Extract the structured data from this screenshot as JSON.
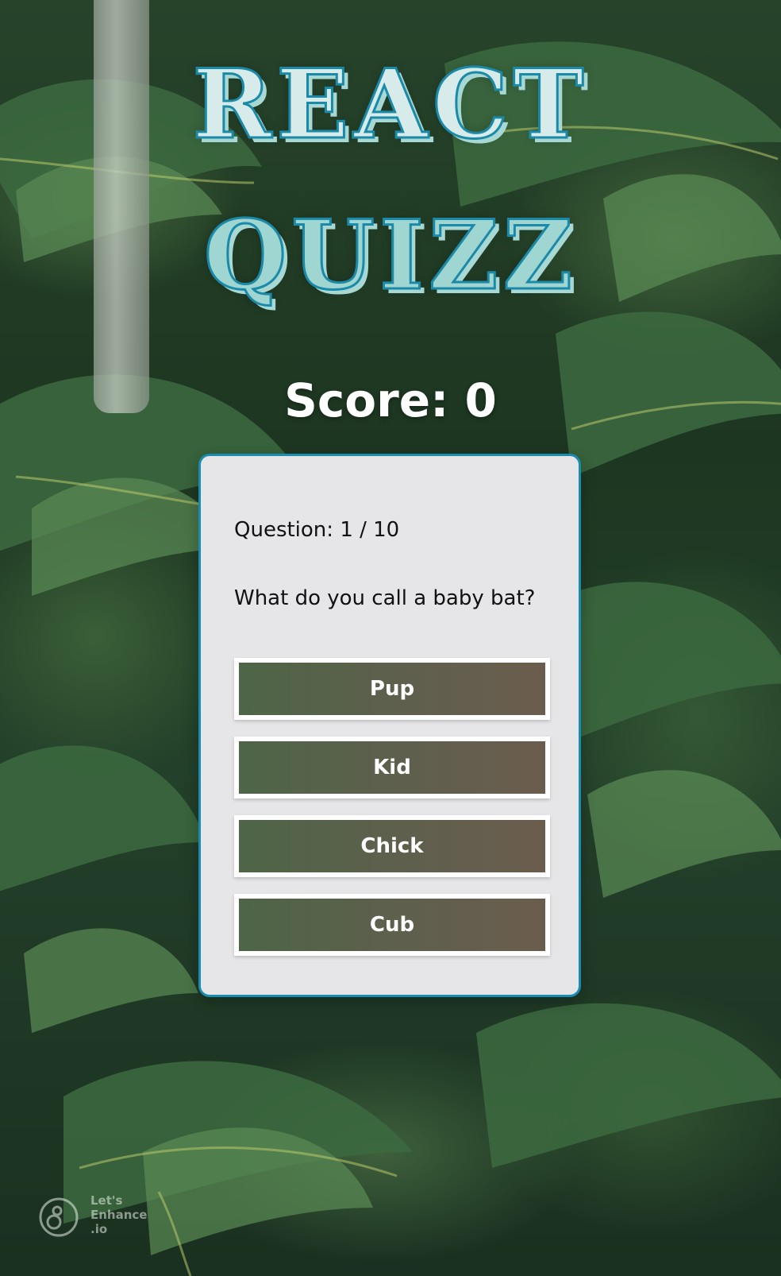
{
  "title": {
    "line1": "REACT",
    "line2": "QUIZZ"
  },
  "score": {
    "label": "Score: 0"
  },
  "card": {
    "question_count": "Question: 1 / 10",
    "question": "What do you call a baby bat?",
    "answers": [
      "Pup",
      "Kid",
      "Chick",
      "Cub"
    ]
  },
  "watermark": {
    "text": "Let's\nEnhance\n.io"
  },
  "colors": {
    "card_border": "#1a8cb0",
    "card_background": "#e6e6e8",
    "answer_button": "#5a6249",
    "title_fill": "#d7ecea",
    "title_outline": "#1b8aa8"
  },
  "background": {
    "description_icon": "monstera-leaves-background"
  }
}
